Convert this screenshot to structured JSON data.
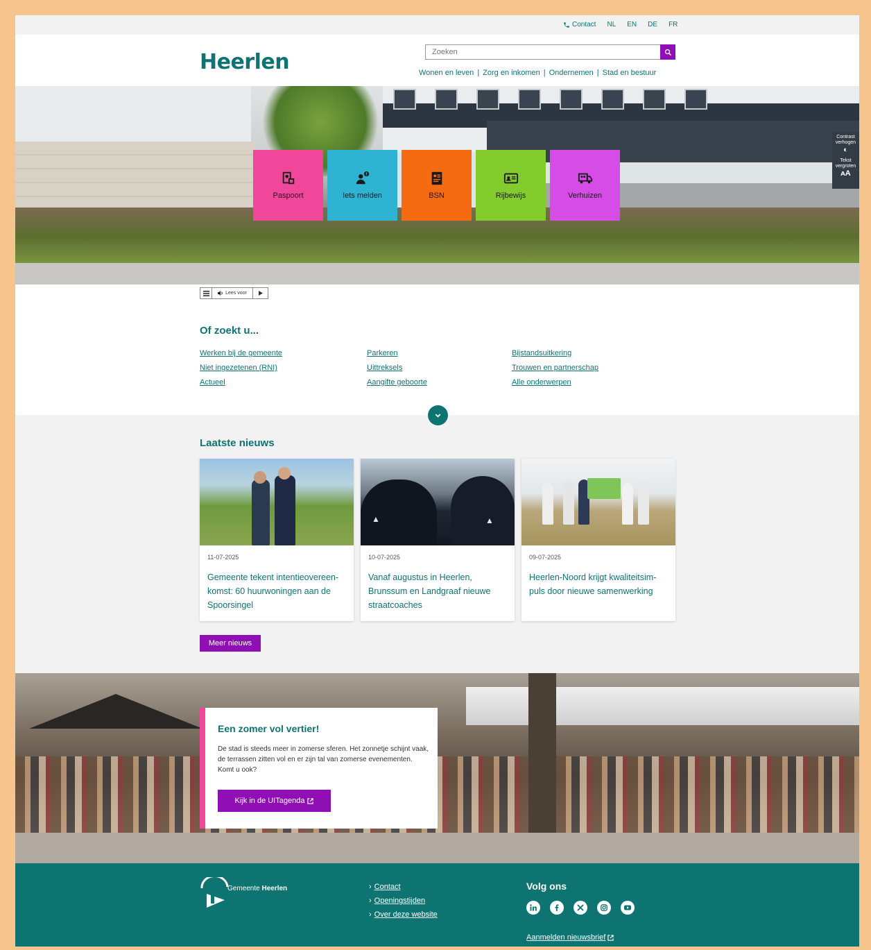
{
  "topbar": {
    "contact": "Contact",
    "languages": [
      "NL",
      "EN",
      "DE",
      "FR"
    ]
  },
  "header": {
    "logo": "Heerlen",
    "search_placeholder": "Zoeken",
    "nav": [
      "Wonen en leven",
      "Zorg en inkomen",
      "Ondernemen",
      "Stad en bestuur"
    ]
  },
  "hero": {
    "tiles": [
      {
        "label": "Paspoort",
        "icon": "passport-icon",
        "color": "#f1479a"
      },
      {
        "label": "Iets melden",
        "icon": "report-icon",
        "color": "#2eb4d2"
      },
      {
        "label": "BSN",
        "icon": "id-document-icon",
        "color": "#f46b12"
      },
      {
        "label": "Rijbewijs",
        "icon": "driving-license-icon",
        "color": "#84cc2e"
      },
      {
        "label": "Verhuizen",
        "icon": "moving-truck-icon",
        "color": "#d54de6"
      }
    ],
    "accessibility": {
      "contrast_line1": "Contrast",
      "contrast_line2": "verhogen",
      "text_line1": "Tekst",
      "text_line2": "vergroten"
    }
  },
  "readspeaker": {
    "label": "Lees voor"
  },
  "of_zoekt_u": {
    "title": "Of zoekt u...",
    "columns": [
      [
        "Werken bij de gemeente",
        "Niet ingezetenen (RNI)",
        "Actueel"
      ],
      [
        "Parkeren",
        "Uittreksels",
        "Aangifte geboorte"
      ],
      [
        "Bijstandsuitkering",
        "Trouwen en partnerschap",
        "Alle onderwerpen"
      ]
    ]
  },
  "news": {
    "title": "Laatste nieuws",
    "items": [
      {
        "date": "11-07-2025",
        "title": "Gemeente tekent intentieovereen-komst: 60 huurwoningen aan de Spoorsingel"
      },
      {
        "date": "10-07-2025",
        "title": "Vanaf augustus in Heerlen, Brunssum en Landgraaf nieuwe straatcoaches"
      },
      {
        "date": "09-07-2025",
        "title": "Heerlen-Noord krijgt kwaliteitsim-puls door nieuwe samenwerking"
      }
    ],
    "more_button": "Meer nieuws"
  },
  "promo": {
    "title": "Een zomer vol vertier!",
    "text": "De stad is steeds meer in zomerse sferen. Het zonnetje schijnt vaak, de terrassen zitten vol en er zijn tal van zomerse evenementen. Komt u ook?",
    "button": "Kijk in de UITagenda"
  },
  "footer": {
    "logo_prefix": "Gemeente ",
    "logo_name": "Heerlen",
    "links": [
      "Contact",
      "Openingstijden",
      "Over deze website"
    ],
    "follow_title": "Volg ons",
    "socials": [
      "linkedin-icon",
      "facebook-icon",
      "x-icon",
      "instagram-icon",
      "youtube-icon"
    ],
    "newsletter": "Aanmelden nieuwsbrief"
  },
  "colors": {
    "brand_teal": "#0d7472",
    "accent_purple": "#8f0fb4",
    "frame": "#f6c48d"
  }
}
